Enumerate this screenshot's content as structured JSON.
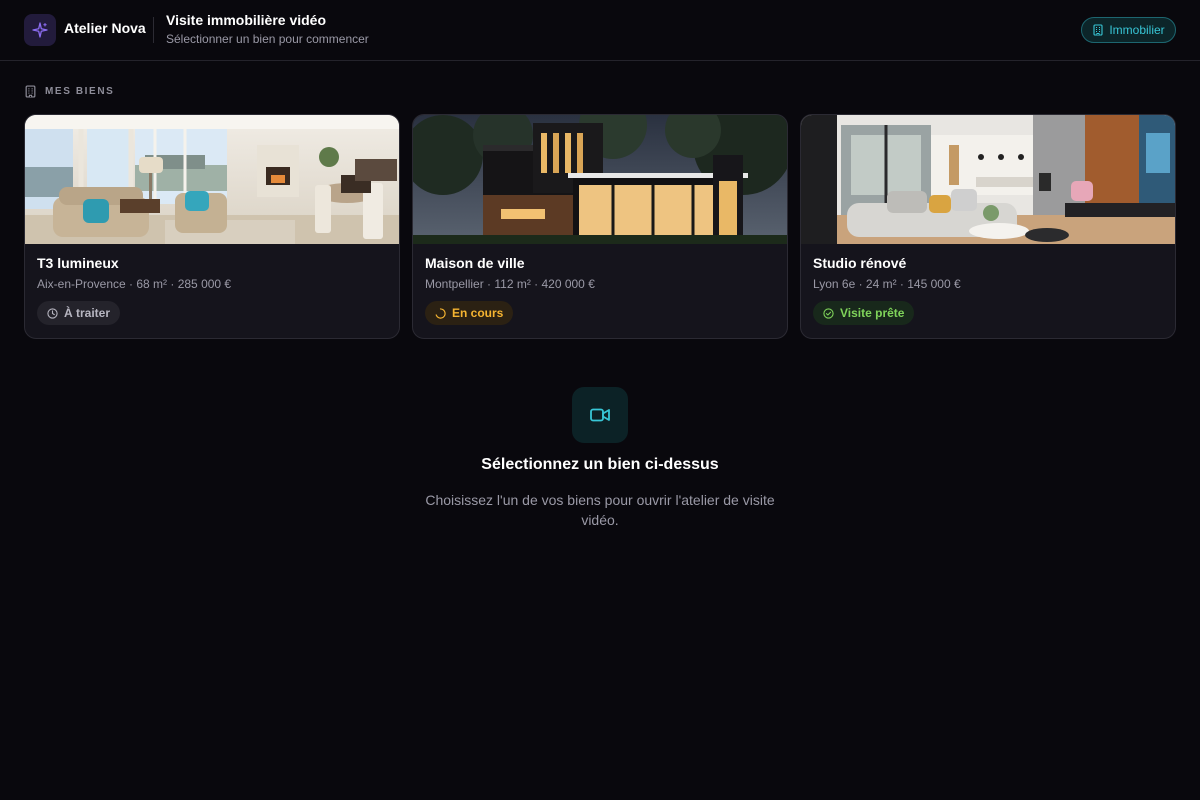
{
  "header": {
    "brand": "Atelier Nova",
    "title": "Visite immobilière vidéo",
    "subtitle": "Sélectionner un bien pour commencer",
    "category_pill": "Immobilier",
    "accent": "#38c6d6",
    "logo_icon": "sparkles-icon"
  },
  "section": {
    "label": "MES BIENS",
    "icon": "building-icon"
  },
  "properties": [
    {
      "title": "T3 lumineux",
      "meta": "Aix-en-Provence · 68 m² · 285 000 €",
      "status": "À traiter",
      "status_icon": "clock-icon",
      "status_color": "#b7b6c1"
    },
    {
      "title": "Maison de ville",
      "meta": "Montpellier · 112 m² · 420 000 €",
      "status": "En cours",
      "status_icon": "spinner-icon",
      "status_color": "#f5b431"
    },
    {
      "title": "Studio rénové",
      "meta": "Lyon 6e · 24 m² · 145 000 €",
      "status": "Visite prête",
      "status_icon": "check-circle-icon",
      "status_color": "#7fd35a"
    }
  ],
  "empty_state": {
    "icon": "video-camera-icon",
    "title": "Sélectionnez un bien ci-dessus",
    "description": "Choisissez l'un de vos biens pour ouvrir l'atelier de visite vidéo."
  }
}
